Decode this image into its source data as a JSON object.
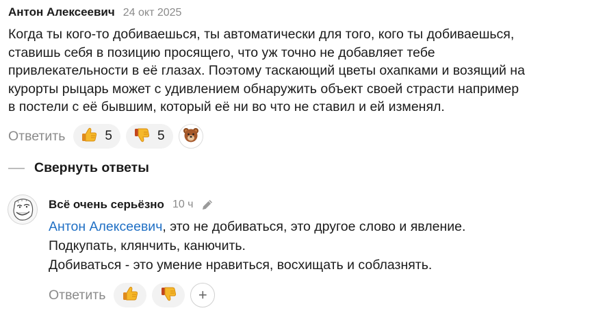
{
  "comment": {
    "author": "Антон Алексеевич",
    "date": "24 окт 2025",
    "lines": [
      "Когда ты кого-то добиваешься, ты автоматически для того, кого ты добиваешься,",
      "ставишь себя в позицию просящего, что уж точно не добавляет тебе",
      "привлекательности в её глазах. Поэтому таскающий цветы охапками и возящий на",
      "курорты рыцарь может с удивлением обнаружить объект своей страсти например",
      "в постели с её бывшим, который её ни во что не ставил и ей изменял."
    ],
    "reply_label": "Ответить",
    "likes": "5",
    "dislikes": "5"
  },
  "collapse_label": "Свернуть ответы",
  "reply": {
    "author": "Всё очень серьёзно",
    "date": "10 ч",
    "mention": "Антон Алексеевич",
    "line1_rest": ", это не добиваться, это другое слово и явление.",
    "line2": "Подкупать, клянчить, канючить.",
    "line3": "Добиваться - это умение нравиться, восхищать и соблазнять.",
    "reply_label": "Ответить",
    "plus": "+"
  },
  "icons": {
    "like": "thumbs-up-icon",
    "dislike": "thumbs-down-icon",
    "bear": "bear-emoji-icon",
    "edit": "pencil-icon",
    "avatar": "troll-face-avatar"
  },
  "colors": {
    "mention": "#1f6fc4",
    "muted": "#8a8a8a",
    "pill_bg": "#f2f2f2",
    "emoji_yellow": "#f5b82a"
  }
}
